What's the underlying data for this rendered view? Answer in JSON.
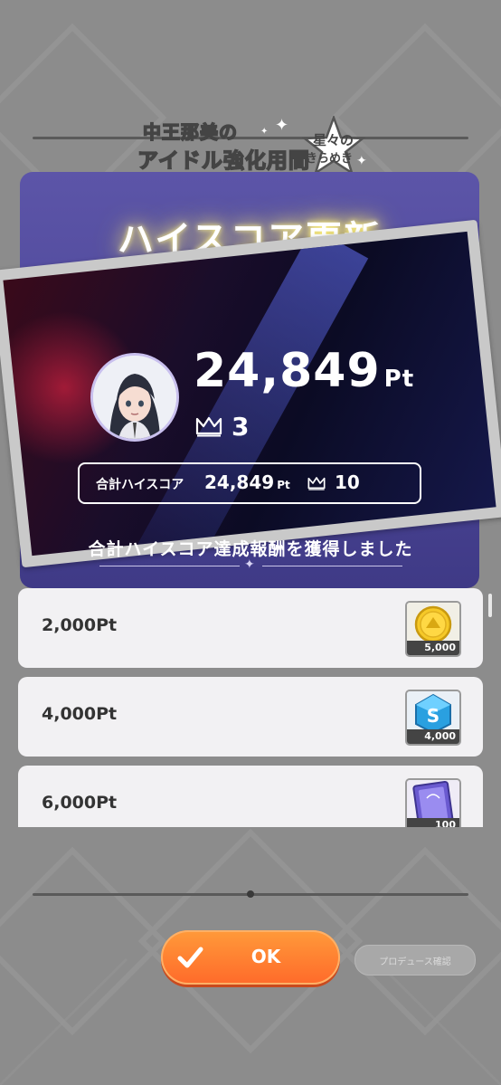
{
  "logo": {
    "line1": "中王那美の",
    "line2": "アイドル強化用間",
    "star_line1": "星々の",
    "star_line2": "きらめき"
  },
  "panel": {
    "title": "ハイスコア更新"
  },
  "score": {
    "value": "24,849",
    "unit": "Pt",
    "crown_count": "3"
  },
  "total": {
    "label": "合計ハイスコア",
    "value": "24,849",
    "unit": "Pt",
    "crown_count": "10"
  },
  "rewards": {
    "heading": "合計ハイスコア達成報酬を獲得しました",
    "items": [
      {
        "label": "2,000Pt",
        "amount": "5,000",
        "icon": "gold-coin-icon"
      },
      {
        "label": "4,000Pt",
        "amount": "4,000",
        "icon": "blue-s-gem-icon"
      },
      {
        "label": "6,000Pt",
        "amount": "100",
        "icon": "purple-card-icon"
      }
    ]
  },
  "buttons": {
    "ok": "OK",
    "produce": "プロデュース確認"
  },
  "colors": {
    "panel": "#4d4698",
    "ok_button": "#ff7a30",
    "background": "#8c8c8c"
  }
}
